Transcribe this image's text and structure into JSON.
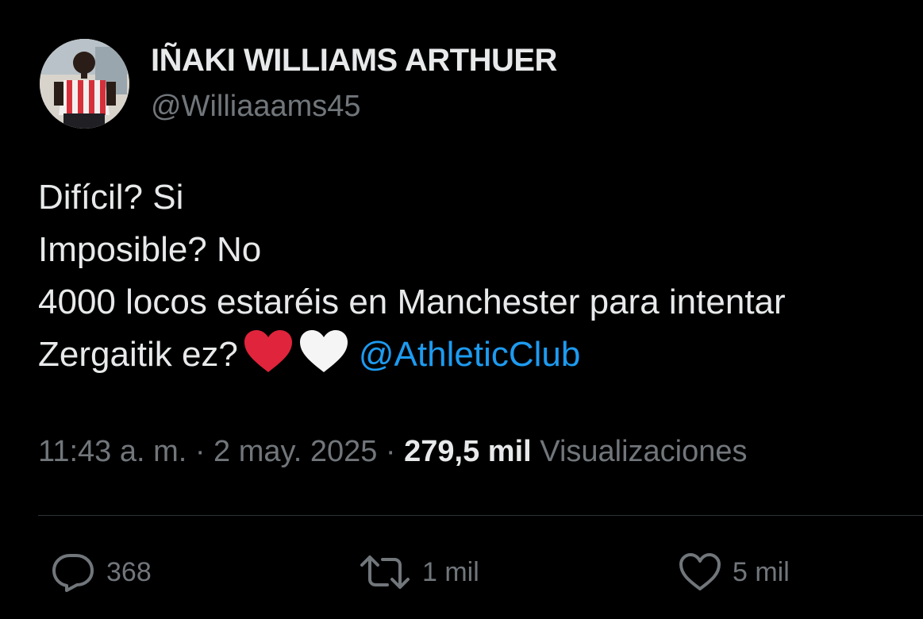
{
  "author": {
    "display_name": "IÑAKI WILLIAMS ARTHUER",
    "handle": "@Williaaams45"
  },
  "tweet": {
    "lines": [
      "Difícil? Si",
      "Imposible? No",
      "4000 locos estaréis en Manchester para intentar"
    ],
    "last_line_text": "Zergaitik ez?",
    "emojis": [
      "red-heart",
      "white-heart"
    ],
    "mention": "@AthleticClub"
  },
  "meta": {
    "timestamp": "11:43 a. m. · 2 may. 2025 ·",
    "views_count": "279,5 mil",
    "views_label": "Visualizaciones"
  },
  "actions": {
    "replies": "368",
    "reposts": "1 mil",
    "likes": "5 mil"
  },
  "colors": {
    "background": "#000000",
    "text_primary": "#e7e9ea",
    "text_secondary": "#71767b",
    "link": "#1d9bf0",
    "heart_red": "#e0243b",
    "divider": "#2f3336"
  }
}
